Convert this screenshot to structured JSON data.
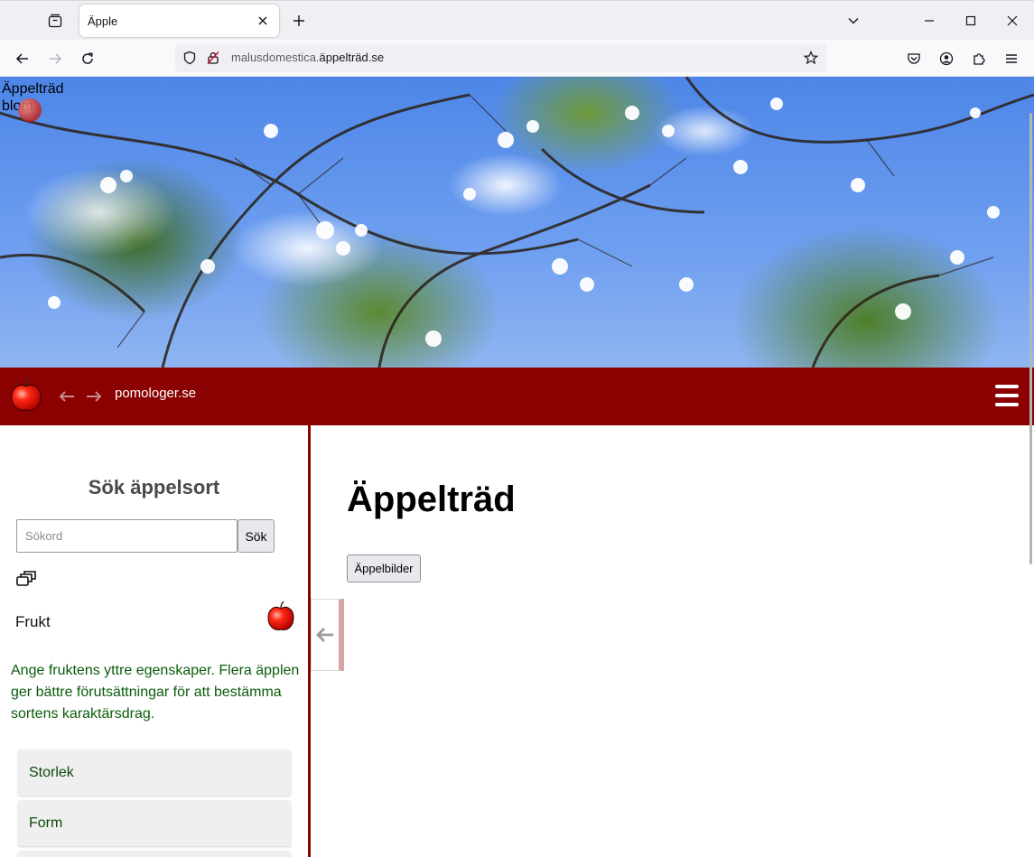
{
  "browser": {
    "tab_title": "Äpple",
    "url_prefix": "malusdomestica.",
    "url_domain": "äppelträd.se"
  },
  "hero": {
    "alt_text": "Äppelträd",
    "alt_text_line2": "blom"
  },
  "header": {
    "site_name": "pomologer.se",
    "brand_color": "#8b0000"
  },
  "sidebar": {
    "search_heading": "Sök äppelsort",
    "search_placeholder": "Sökord",
    "search_button": "Sök",
    "section_title": "Frukt",
    "description": "Ange fruktens yttre egenskaper. Flera äpplen ger bättre förutsättningar för att bestämma sortens karaktärsdrag.",
    "accordion": [
      {
        "label": "Storlek"
      },
      {
        "label": "Form"
      },
      {
        "label": ""
      }
    ]
  },
  "main": {
    "title": "Äppelträd",
    "button": "Äppelbilder"
  }
}
